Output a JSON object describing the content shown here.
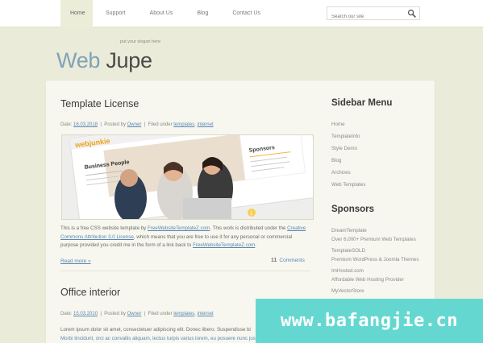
{
  "nav": {
    "items": [
      "Home",
      "Support",
      "About Us",
      "Blog",
      "Contact Us"
    ],
    "active_index": 0
  },
  "search": {
    "placeholder": "Search our site"
  },
  "header": {
    "slogan": "put your slogan here",
    "logo_part1": "Web",
    "logo_part2": "Jupe"
  },
  "posts": [
    {
      "title": "Template License",
      "meta": {
        "date_label": "Date:",
        "date": "16.03.2018",
        "posted_by_label": "Posted by",
        "author": "Owner",
        "filed_label": "Filed under",
        "tag1": "templates",
        "tag2": "internet"
      },
      "image": {
        "logo": "webjunkie",
        "banner": "Business People",
        "sponsors_label": "Sponsors"
      },
      "text_parts": [
        "This is a free CSS website template by ",
        "FreeWebsiteTemplateZ.com",
        ". This work is distributed under the ",
        "Creative Commons Attribution 3.0 License",
        ", which means that you are free to use it for any personal or commercial purpose provided you credit me in the form of a link back to ",
        "FreeWebsiteTemplateZ.com",
        "."
      ],
      "read_more": "Read more »",
      "comment_count": "11",
      "comments_label": "Comments"
    },
    {
      "title": "Office interior",
      "meta": {
        "date_label": "Date:",
        "date": "15.03.2010",
        "posted_by_label": "Posted by",
        "author": "Owner",
        "filed_label": "Filed under",
        "tag1": "templates",
        "tag2": "internet"
      },
      "text_line1": "Lorem ipsum dolor sit amet, consectetuer adipiscing elit. Donec libero. Suspendisse bi",
      "text_line2": "Morbi tincidunt, orci ac convallis aliquam, lectus turpis varius lorem, eu posuere nunc justo"
    }
  ],
  "sidebar": {
    "menu_title": "Sidebar Menu",
    "links": [
      "Home",
      "TemplateInfo",
      "Style Demo",
      "Blog",
      "Archives",
      "Web Templates"
    ],
    "sponsors_title": "Sponsors",
    "sponsors": [
      {
        "name": "DreamTemplate",
        "desc": "Over 6,000+ Premium Web Templates"
      },
      {
        "name": "TemplateSOLD",
        "desc": "Premium WordPress & Joomla Themes"
      },
      {
        "name": "ImHosted.com",
        "desc": "Affordable Web Hosting Provider"
      },
      {
        "name": "MyVectorStore",
        "desc": ""
      }
    ]
  },
  "watermark": "www.bafangjie.cn",
  "colors": {
    "page_bg": "#ebebd9",
    "panel_bg": "#f7f7ef",
    "link": "#5a86b0",
    "logo_web": "#7ea2b8",
    "logo_jupe": "#4a4a4a",
    "watermark_bg": "#64d8d0"
  }
}
